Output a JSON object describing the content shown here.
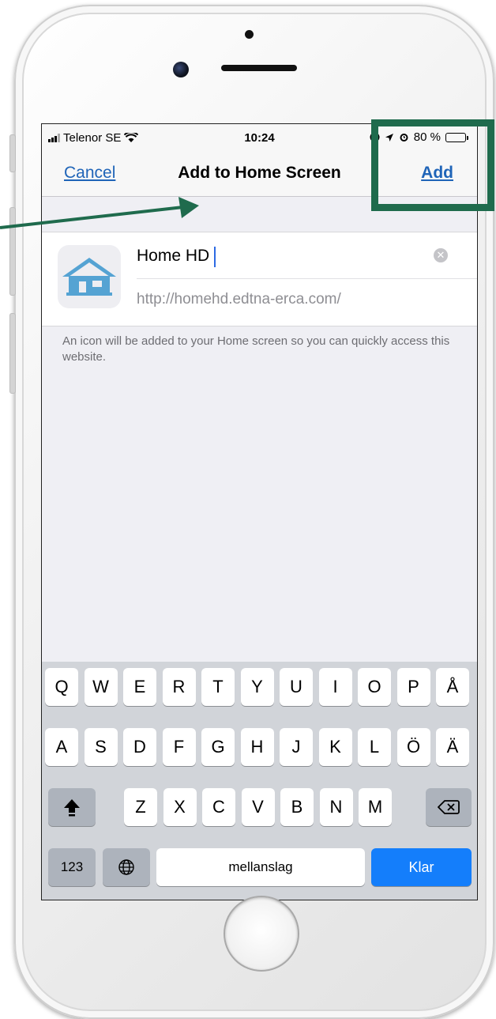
{
  "status": {
    "carrier": "Telenor SE",
    "time": "10:24",
    "battery": "80 %",
    "battery_level": 0.8
  },
  "nav": {
    "cancel": "Cancel",
    "title": "Add to Home Screen",
    "add": "Add"
  },
  "form": {
    "name_value": "Home HD",
    "url": "http://homehd.edtna-erca.com/",
    "help": "An icon will be added to your Home screen so you can quickly access this website."
  },
  "keyboard": {
    "row1": [
      "Q",
      "W",
      "E",
      "R",
      "T",
      "Y",
      "U",
      "I",
      "O",
      "P",
      "Å"
    ],
    "row2": [
      "A",
      "S",
      "D",
      "F",
      "G",
      "H",
      "J",
      "K",
      "L",
      "Ö",
      "Ä"
    ],
    "row3": [
      "Z",
      "X",
      "C",
      "V",
      "B",
      "N",
      "M"
    ],
    "numbers": "123",
    "space": "mellanslag",
    "done": "Klar"
  },
  "colors": {
    "link_blue": "#1f64b8",
    "annotation_green": "#1f6b4d",
    "keyboard_accent": "#147efb"
  }
}
